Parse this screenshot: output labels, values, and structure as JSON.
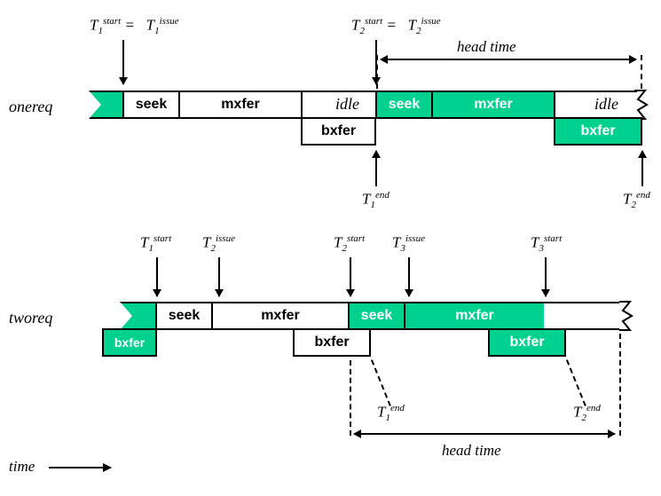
{
  "labels": {
    "onereq": "onereq",
    "tworeq": "tworeq",
    "time": "time",
    "head_time": "head time",
    "idle": "idle"
  },
  "phases": {
    "seek": "seek",
    "mxfer": "mxfer",
    "bxfer": "bxfer"
  },
  "markers": {
    "T1_start": "T",
    "T1_issue": "T",
    "T2_start": "T",
    "T2_issue": "T",
    "T3_issue": "T",
    "T3_start": "T",
    "T1_end": "T",
    "T2_end": "T",
    "subs": {
      "1": "1",
      "2": "2",
      "3": "3"
    },
    "sups": {
      "start": "start",
      "issue": "issue",
      "end": "end"
    },
    "eq": "="
  },
  "chart_data": {
    "type": "diagram",
    "title": "Disk request scheduling timelines: onereq vs tworeq",
    "timelines": [
      {
        "name": "onereq",
        "lane_main": [
          {
            "phase": "prefix",
            "color": "green"
          },
          {
            "phase": "seek",
            "color": "white"
          },
          {
            "phase": "mxfer",
            "color": "white"
          },
          {
            "phase": "idle",
            "color": "none"
          },
          {
            "phase": "seek",
            "color": "green"
          },
          {
            "phase": "mxfer",
            "color": "green"
          },
          {
            "phase": "idle",
            "color": "none"
          }
        ],
        "lane_bxfer": [
          {
            "phase": "bxfer",
            "after": "mxfer#1",
            "color": "white"
          },
          {
            "phase": "bxfer",
            "after": "mxfer#2",
            "color": "green"
          }
        ],
        "markers_top": [
          {
            "label": "T1_start = T1_issue",
            "at": "seek#1.start"
          },
          {
            "label": "T2_start = T2_issue",
            "at": "seek#2.start"
          }
        ],
        "markers_bottom": [
          {
            "label": "T1_end",
            "at": "bxfer#1.end"
          },
          {
            "label": "T2_end",
            "at": "bxfer#2.end"
          }
        ],
        "head_time_span": [
          "seek#2.start",
          "bxfer#2.end"
        ]
      },
      {
        "name": "tworeq",
        "lane_main": [
          {
            "phase": "prefix",
            "color": "green"
          },
          {
            "phase": "seek",
            "color": "white"
          },
          {
            "phase": "mxfer",
            "color": "white"
          },
          {
            "phase": "seek",
            "color": "green"
          },
          {
            "phase": "mxfer",
            "color": "green"
          },
          {
            "phase": "trailing",
            "color": "white"
          }
        ],
        "lane_bxfer": [
          {
            "phase": "bxfer",
            "before": "seek#1",
            "color": "green"
          },
          {
            "phase": "bxfer",
            "after": "mxfer#1",
            "color": "white"
          },
          {
            "phase": "bxfer",
            "after": "mxfer#2",
            "color": "green"
          }
        ],
        "markers_top": [
          {
            "label": "T1_start",
            "at": "seek#1.start"
          },
          {
            "label": "T2_issue",
            "at": "seek#1.mid"
          },
          {
            "label": "T2_start",
            "at": "seek#2.start"
          },
          {
            "label": "T3_issue",
            "at": "seek#2.mid"
          },
          {
            "label": "T3_start",
            "at": "mxfer#2.end"
          }
        ],
        "markers_bottom": [
          {
            "label": "T1_end",
            "at": "bxfer#2.end"
          },
          {
            "label": "T2_end",
            "at": "bxfer#3.end"
          }
        ],
        "head_time_span": [
          "seek#2.start",
          "mxfer#2.end+trailing"
        ]
      }
    ]
  }
}
